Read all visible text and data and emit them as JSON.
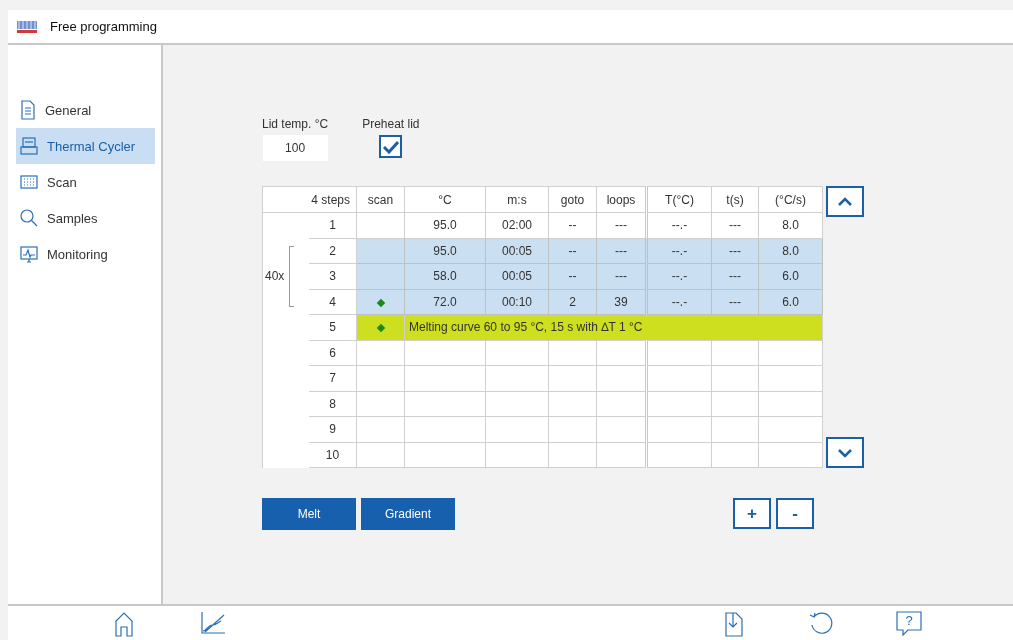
{
  "window": {
    "title": "Free programming"
  },
  "sidebar": {
    "items": [
      {
        "label": "General",
        "selected": false
      },
      {
        "label": "Thermal Cycler",
        "selected": true
      },
      {
        "label": "Scan",
        "selected": false
      },
      {
        "label": "Samples",
        "selected": false
      },
      {
        "label": "Monitoring",
        "selected": false
      }
    ]
  },
  "lid": {
    "label": "Lid temp. °C",
    "value": "100"
  },
  "preheat": {
    "label": "Preheat lid",
    "checked": true
  },
  "table": {
    "columns": [
      "4  steps",
      "scan",
      "°C",
      "m:s",
      "goto",
      "loops",
      "T(°C)",
      "t(s)",
      "(°C/s)"
    ],
    "loop_label": "40x",
    "rows": [
      {
        "kind": "step",
        "number": "1",
        "scan": false,
        "in_loop": false,
        "cells": [
          "95.0",
          "02:00",
          "--",
          "---",
          "--.-",
          "---",
          "8.0"
        ]
      },
      {
        "kind": "step",
        "number": "2",
        "scan": false,
        "in_loop": true,
        "cells": [
          "95.0",
          "00:05",
          "--",
          "---",
          "--.-",
          "---",
          "8.0"
        ]
      },
      {
        "kind": "step",
        "number": "3",
        "scan": false,
        "in_loop": true,
        "cells": [
          "58.0",
          "00:05",
          "--",
          "---",
          "--.-",
          "---",
          "6.0"
        ]
      },
      {
        "kind": "step",
        "number": "4",
        "scan": true,
        "in_loop": true,
        "cells": [
          "72.0",
          "00:10",
          "2",
          "39",
          "--.-",
          "---",
          "6.0"
        ]
      },
      {
        "kind": "melt",
        "number": "5",
        "scan": true,
        "in_loop": false,
        "text": "Melting curve 60 to 95 °C, 15 s with ∆T 1 °C"
      },
      {
        "kind": "empty",
        "number": "6"
      },
      {
        "kind": "empty",
        "number": "7"
      },
      {
        "kind": "empty",
        "number": "8"
      },
      {
        "kind": "empty",
        "number": "9"
      },
      {
        "kind": "empty",
        "number": "10"
      }
    ]
  },
  "buttons": [
    "Melt",
    "Gradient"
  ],
  "step_buttons": [
    "+",
    "-"
  ],
  "bottom_bar": {
    "help_label": "?"
  }
}
